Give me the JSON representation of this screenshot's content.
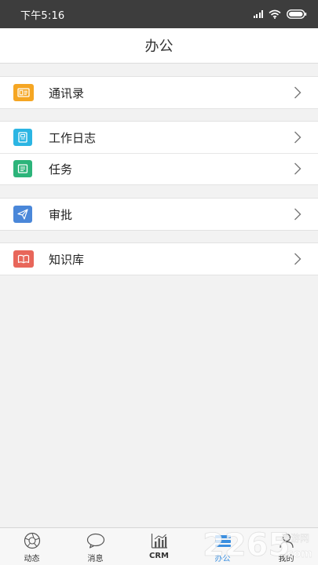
{
  "status_bar": {
    "time": "下午5:16"
  },
  "header": {
    "title": "办公"
  },
  "menu_groups": [
    {
      "items": [
        {
          "label": "通讯录",
          "icon": "contact-card-icon",
          "color": "#f5a623"
        }
      ]
    },
    {
      "items": [
        {
          "label": "工作日志",
          "icon": "journal-icon",
          "color": "#2bb5e3"
        },
        {
          "label": "任务",
          "icon": "task-icon",
          "color": "#2cb47a"
        }
      ]
    },
    {
      "items": [
        {
          "label": "审批",
          "icon": "paper-plane-icon",
          "color": "#4a87d9"
        }
      ]
    },
    {
      "items": [
        {
          "label": "知识库",
          "icon": "open-book-icon",
          "color": "#e8665a"
        }
      ]
    }
  ],
  "tab_bar": {
    "items": [
      {
        "label": "动态",
        "icon": "aperture-icon"
      },
      {
        "label": "消息",
        "icon": "chat-bubble-icon"
      },
      {
        "label": "CRM",
        "icon": "bar-chart-icon"
      },
      {
        "label": "办公",
        "icon": "office-icon",
        "active": true
      },
      {
        "label": "我的",
        "icon": "user-icon"
      }
    ],
    "active_color": "#3b8fe0"
  },
  "watermark": {
    "number": "2265",
    "suffix": "手游网",
    "domain": ".com"
  }
}
